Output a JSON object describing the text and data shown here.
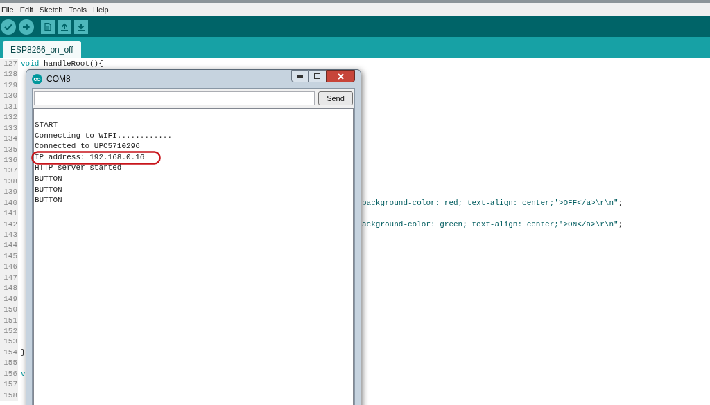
{
  "menu": [
    "File",
    "Edit",
    "Sketch",
    "Tools",
    "Help"
  ],
  "toolbar": [
    {
      "kind": "round"
    },
    {
      "kind": "round"
    },
    {
      "kind": "square"
    },
    {
      "kind": "square"
    },
    {
      "kind": "square"
    }
  ],
  "tabs": [
    {
      "label": "ESP8266_on_off",
      "selected": true
    }
  ],
  "editor": {
    "lines": [
      {
        "number": "127",
        "kind": "code",
        "tokens": [
          {
            "text": "void",
            "kind": "keyword"
          },
          {
            "text": " handleRoot(){",
            "kind": "plain"
          }
        ]
      },
      {
        "number": "128"
      },
      {
        "number": "129"
      },
      {
        "number": "130"
      },
      {
        "number": "131"
      },
      {
        "number": "132"
      },
      {
        "number": "133"
      },
      {
        "number": "134"
      },
      {
        "number": "135"
      },
      {
        "number": "136"
      },
      {
        "number": "137"
      },
      {
        "number": "138"
      },
      {
        "number": "139"
      },
      {
        "number": "140",
        "kind": "tail",
        "tokens": [
          {
            "text": "background-color: red; text-align: center;'>OFF</a>\\r\\n\"",
            "kind": "string"
          },
          {
            "text": ";",
            "kind": "plain"
          }
        ]
      },
      {
        "number": "141"
      },
      {
        "number": "142",
        "kind": "tail",
        "tokens": [
          {
            "text": "ackground-color: green; text-align: center;'>ON</a>\\r\\n\"",
            "kind": "string"
          },
          {
            "text": ";",
            "kind": "plain"
          }
        ]
      },
      {
        "number": "143"
      },
      {
        "number": "144"
      },
      {
        "number": "145"
      },
      {
        "number": "146"
      },
      {
        "number": "147"
      },
      {
        "number": "148"
      },
      {
        "number": "149"
      },
      {
        "number": "150"
      },
      {
        "number": "151"
      },
      {
        "number": "152"
      },
      {
        "number": "153"
      },
      {
        "number": "154",
        "kind": "code",
        "tokens": [
          {
            "text": "}",
            "kind": "plain"
          }
        ]
      },
      {
        "number": "155"
      },
      {
        "number": "156",
        "kind": "code",
        "tokens": [
          {
            "text": "v",
            "kind": "keyword"
          }
        ]
      },
      {
        "number": "157"
      },
      {
        "number": "158"
      }
    ]
  },
  "serial_monitor": {
    "title": "COM8",
    "send_button": "Send",
    "output": [
      {
        "text": "START",
        "highlighted": false
      },
      {
        "text": "Connecting to WIFI............",
        "highlighted": false
      },
      {
        "text": "Connected to UPC5710296",
        "highlighted": false
      },
      {
        "text": "IP address: 192.168.0.16",
        "highlighted": true
      },
      {
        "text": "HTTP server started",
        "highlighted": false
      },
      {
        "text": "BUTTON",
        "highlighted": false
      },
      {
        "text": "BUTTON",
        "highlighted": false
      },
      {
        "text": "BUTTON",
        "highlighted": false
      }
    ]
  }
}
